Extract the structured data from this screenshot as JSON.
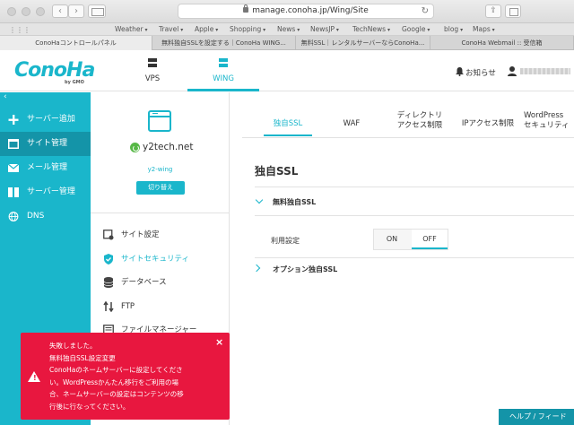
{
  "browser": {
    "url": "manage.conoha.jp/Wing/Site",
    "bookmarks": [
      "Weather",
      "Travel",
      "Apple",
      "Shopping",
      "News",
      "NewsJP",
      "TechNews",
      "Google",
      "blog",
      "Maps"
    ],
    "tabs": [
      "ConoHaコントロールパネル",
      "無料独自SSLを設定する｜ConoHa WING...",
      "無料SSL｜レンタルサーバーならConoHa...",
      "ConoHa Webmail :: 受信箱"
    ]
  },
  "header": {
    "logo": "ConoHa",
    "logo_sub": "by GMO",
    "nav": [
      {
        "label": "VPS"
      },
      {
        "label": "WING"
      }
    ],
    "notice": "お知らせ"
  },
  "leftnav": {
    "collapse": "‹",
    "items": [
      {
        "label": "サーバー追加",
        "icon": "plus-icon"
      },
      {
        "label": "サイト管理",
        "icon": "site-icon"
      },
      {
        "label": "メール管理",
        "icon": "mail-icon"
      },
      {
        "label": "サーバー管理",
        "icon": "server-icon"
      },
      {
        "label": "DNS",
        "icon": "globe-icon"
      }
    ]
  },
  "site": {
    "name": "y2tech.net",
    "sub": "y2-wing",
    "switch_label": "切り替え",
    "menu": [
      {
        "label": "サイト設定",
        "icon": "site-settings-icon"
      },
      {
        "label": "サイトセキュリティ",
        "icon": "shield-icon"
      },
      {
        "label": "データベース",
        "icon": "database-icon"
      },
      {
        "label": "FTP",
        "icon": "ftp-icon"
      },
      {
        "label": "ファイルマネージャー",
        "icon": "file-manager-icon"
      }
    ]
  },
  "content": {
    "tabs": [
      {
        "label": "独自SSL"
      },
      {
        "label": "WAF"
      },
      {
        "label": "ディレクトリ\nアクセス制限"
      },
      {
        "label": "IPアクセス制限"
      },
      {
        "label": "WordPress\nセキュリティ"
      }
    ],
    "title": "独自SSL",
    "section1": "無料独自SSL",
    "use_label": "利用設定",
    "toggle": {
      "on": "ON",
      "off": "OFF",
      "selected": "OFF"
    },
    "section2": "オプション独自SSL"
  },
  "toast": {
    "message": "失敗しました。\n無料独自SSL設定変更\nConoHaのネームサーバーに設定してくださ\nい。WordPressかんたん移行をご利用の場\n合、ネームサーバーの設定はコンテンツの移\n行後に行なってください。",
    "close": "×"
  },
  "help": "ヘルプ / フィード",
  "colors": {
    "accent": "#1ab6cb",
    "nav_active": "#1494a8",
    "error": "#e8173f"
  }
}
